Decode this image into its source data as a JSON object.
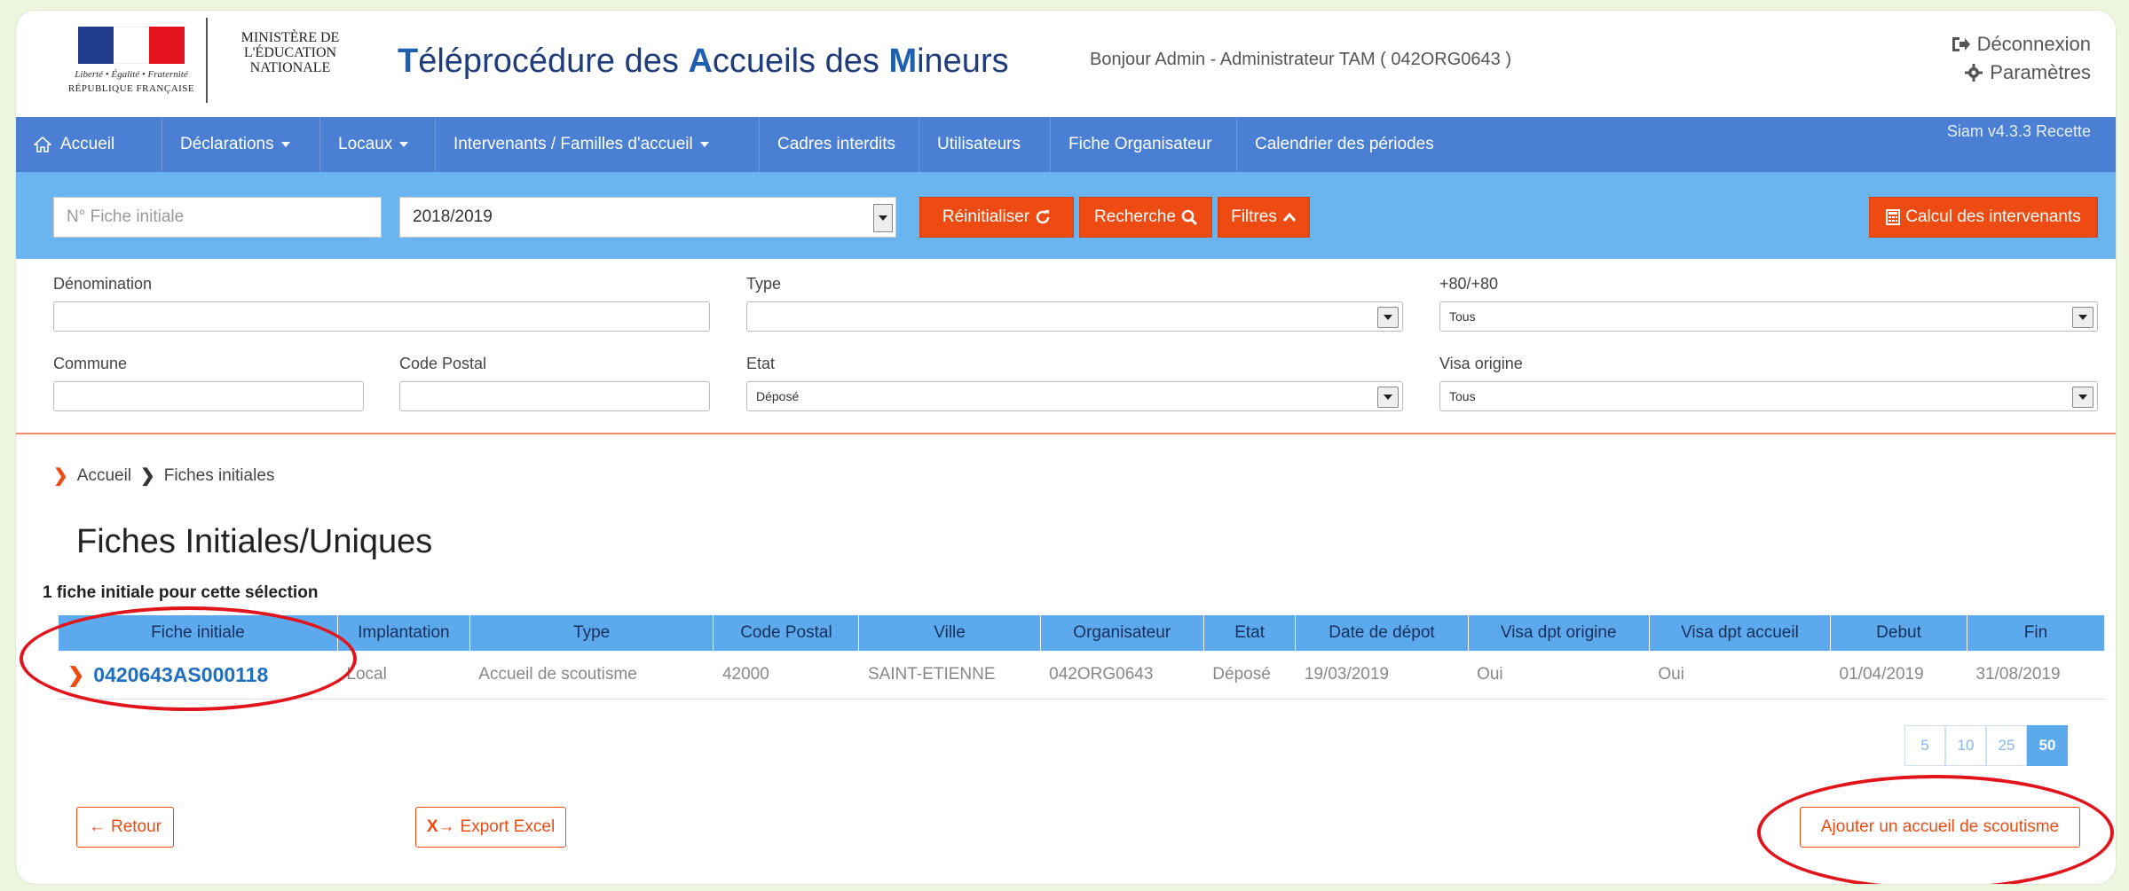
{
  "header": {
    "logo": {
      "motto": "Liberté • Égalité • Fraternité",
      "republic": "RÉPUBLIQUE FRANÇAISE",
      "flag_colors": [
        "#1f3d8c",
        "#ffffff",
        "#e2131c"
      ]
    },
    "ministry": "MINISTÈRE DE L'ÉDUCATION NATIONALE",
    "app_title": {
      "t1": "T",
      "t2": "éléprocédure des ",
      "a1": "A",
      "a2": "ccueils des ",
      "m1": "M",
      "m2": "ineurs"
    },
    "greeting": "Bonjour Admin - Administrateur TAM ( 042ORG0643 )",
    "logout_label": "Déconnexion",
    "logout_icon": "sign-out-icon",
    "settings_label": "Paramètres",
    "settings_icon": "gear-icon"
  },
  "nav": {
    "home_icon": "home-icon",
    "items": [
      {
        "label": "Accueil"
      },
      {
        "label": "Déclarations"
      },
      {
        "label": "Locaux"
      },
      {
        "label": "Intervenants / Familles d'accueil"
      },
      {
        "label": "Cadres interdits"
      },
      {
        "label": "Utilisateurs"
      },
      {
        "label": "Fiche Organisateur"
      },
      {
        "label": "Calendrier des périodes"
      }
    ],
    "version": "Siam v4.3.3 Recette"
  },
  "filterbar": {
    "fiche_placeholder": "N° Fiche initiale",
    "year_value": "2018/2019",
    "reset_label": "Réinitialiser",
    "search_label": "Recherche",
    "filters_label": "Filtres",
    "calc_label": "Calcul des intervenants",
    "accent": "#ee4b12"
  },
  "form": {
    "denomination_label": "Dénomination",
    "denomination_value": "",
    "type_label": "Type",
    "type_value": "",
    "plus80_label": "+80/+80",
    "plus80_value": "Tous",
    "commune_label": "Commune",
    "commune_value": "",
    "code_postal_label": "Code Postal",
    "code_postal_value": "",
    "etat_label": "Etat",
    "etat_value": "Déposé",
    "visa_label": "Visa origine",
    "visa_value": "Tous"
  },
  "breadcrumb": [
    "Accueil",
    "Fiches initiales"
  ],
  "page_title": "Fiches Initiales/Uniques",
  "count_text": "1 fiche initiale pour cette sélection",
  "table": {
    "headers": [
      "Fiche initiale",
      "Implantation",
      "Type",
      "Code Postal",
      "Ville",
      "Organisateur",
      "Etat",
      "Date de dépot",
      "Visa dpt origine",
      "Visa dpt accueil",
      "Debut",
      "Fin"
    ],
    "rows": [
      [
        "0420643AS000118",
        "Local",
        "Accueil de scoutisme",
        "42000",
        "SAINT-ETIENNE",
        "042ORG0643",
        "Déposé",
        "19/03/2019",
        "Oui",
        "Oui",
        "01/04/2019",
        "31/08/2019"
      ]
    ]
  },
  "pagination": {
    "options": [
      "5",
      "10",
      "25",
      "50"
    ],
    "active": "50"
  },
  "actions": {
    "back_label": "Retour",
    "export_label": "Export Excel",
    "add_label": "Ajouter un accueil de scoutisme"
  }
}
